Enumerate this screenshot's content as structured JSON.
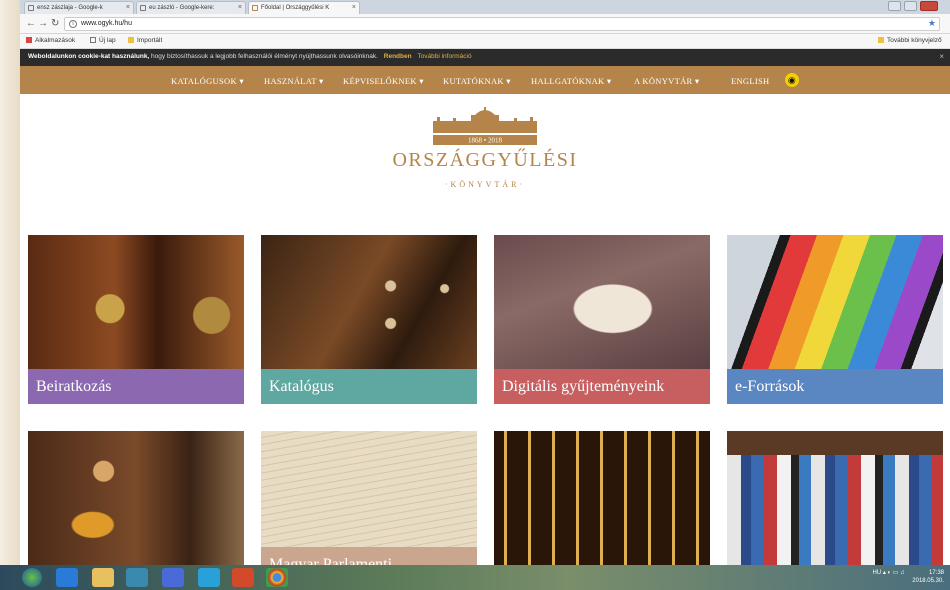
{
  "browser": {
    "tabs": [
      {
        "label": "ensz zászlaja - Google-k"
      },
      {
        "label": "eu zászló - Google-kere:"
      },
      {
        "label": "Főoldal | Országgyűlési K"
      }
    ],
    "url": "www.ogyk.hu/hu",
    "bookmarks": {
      "apps": "Alkalmazások",
      "new_tab": "Új lap",
      "imported": "Importált",
      "other": "További könyvjelző"
    }
  },
  "cookie_bar": {
    "title": "Weboldalunkon cookie-kat használunk,",
    "text": "hogy biztosíthassuk a legjobb felhasználói élményt nyújthassunk olvasóinknak.",
    "accept": "Rendben",
    "more_info": "További információ",
    "close": "×"
  },
  "nav": {
    "items": [
      "KATALÓGUSOK ▾",
      "HASZNÁLAT ▾",
      "KÉPVISELŐKNEK ▾",
      "KUTATÓKNAK ▾",
      "HALLGATÓKNAK ▾",
      "A KÖNYVTÁR ▾",
      "ENGLISH"
    ]
  },
  "logo": {
    "years": "1868 • 2018",
    "name": "ORSZÁGGYŰLÉSI",
    "sub": "·KÖNYVTÁR·"
  },
  "tiles": [
    {
      "label": "Beiratkozás",
      "color": "#8b68b0"
    },
    {
      "label": "Katalógus",
      "color": "#5fa7a1"
    },
    {
      "label": "Digitális gyűjteményeink",
      "color": "#c75f60"
    },
    {
      "label": "e-Források",
      "color": "#5a86c2"
    },
    {
      "label": ""
    },
    {
      "label": "Magyar Parlamenti",
      "color": "#c9a68d"
    },
    {
      "label": ""
    },
    {
      "label": ""
    }
  ],
  "taskbar": {
    "tray_icons": "HU",
    "time": "17:38",
    "date": "2018.05.30."
  }
}
